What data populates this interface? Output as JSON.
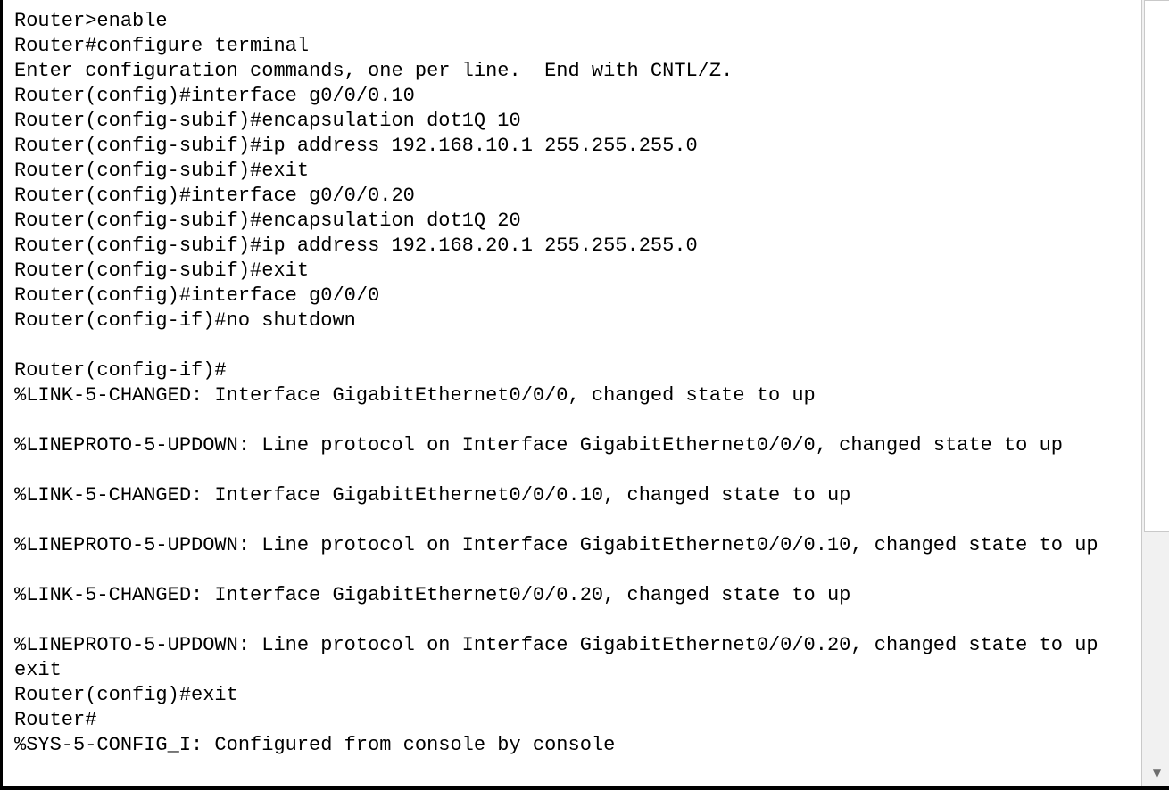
{
  "terminal": {
    "lines": [
      "Router>enable",
      "Router#configure terminal",
      "Enter configuration commands, one per line.  End with CNTL/Z.",
      "Router(config)#interface g0/0/0.10",
      "Router(config-subif)#encapsulation dot1Q 10",
      "Router(config-subif)#ip address 192.168.10.1 255.255.255.0",
      "Router(config-subif)#exit",
      "Router(config)#interface g0/0/0.20",
      "Router(config-subif)#encapsulation dot1Q 20",
      "Router(config-subif)#ip address 192.168.20.1 255.255.255.0",
      "Router(config-subif)#exit",
      "Router(config)#interface g0/0/0",
      "Router(config-if)#no shutdown",
      "",
      "Router(config-if)#",
      "%LINK-5-CHANGED: Interface GigabitEthernet0/0/0, changed state to up",
      "",
      "%LINEPROTO-5-UPDOWN: Line protocol on Interface GigabitEthernet0/0/0, changed state to up",
      "",
      "%LINK-5-CHANGED: Interface GigabitEthernet0/0/0.10, changed state to up",
      "",
      "%LINEPROTO-5-UPDOWN: Line protocol on Interface GigabitEthernet0/0/0.10, changed state to up",
      "",
      "%LINK-5-CHANGED: Interface GigabitEthernet0/0/0.20, changed state to up",
      "",
      "%LINEPROTO-5-UPDOWN: Line protocol on Interface GigabitEthernet0/0/0.20, changed state to up",
      "exit",
      "Router(config)#exit",
      "Router#",
      "%SYS-5-CONFIG_I: Configured from console by console"
    ]
  },
  "scrollbar": {
    "down_arrow": "▼",
    "scroll_position": 0
  }
}
